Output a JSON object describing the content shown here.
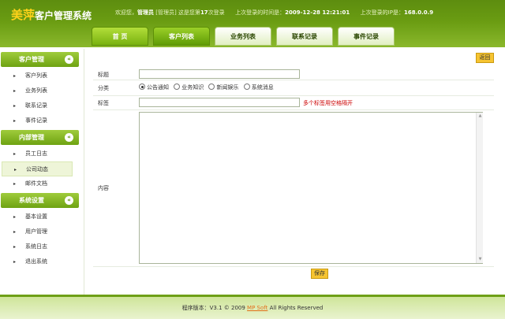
{
  "header": {
    "logo_brand": "美萍",
    "logo_rest": "客户管理系统",
    "welcome_prefix": "欢迎您，",
    "user": "管理员",
    "role": "[管理员]",
    "login_count_prefix": "这是您第",
    "login_count": "17",
    "login_count_suffix": "次登录",
    "last_time_label": "上次登录的时间是：",
    "last_time": "2009-12-28 12:21:01",
    "last_ip_label": "上次登录的IP是：",
    "last_ip": "168.0.0.9"
  },
  "tabs": [
    {
      "label": "首 页"
    },
    {
      "label": "客户列表"
    },
    {
      "label": "业务列表"
    },
    {
      "label": "联系记录"
    },
    {
      "label": "事件记录"
    }
  ],
  "sidebar": {
    "sections": [
      {
        "title": "客户管理",
        "items": [
          "客户列表",
          "业务列表",
          "联系记录",
          "事件记录"
        ]
      },
      {
        "title": "内部管理",
        "items": [
          "员工日志",
          "公司动态",
          "邮件文档"
        ]
      },
      {
        "title": "系统设置",
        "items": [
          "基本设置",
          "用户管理",
          "系统日志",
          "退出系统"
        ]
      }
    ],
    "chevron": "«"
  },
  "main": {
    "back_label": "返回",
    "title_label": "标题",
    "title_value": "",
    "category_label": "分类",
    "categories": [
      {
        "label": "公告通知",
        "checked": true
      },
      {
        "label": "业务知识",
        "checked": false
      },
      {
        "label": "新闻娱乐",
        "checked": false
      },
      {
        "label": "系统消息",
        "checked": false
      }
    ],
    "tags_label": "标签",
    "tags_value": "",
    "tags_hint": "多个标签用空格隔开",
    "content_label": "内容",
    "content_value": "",
    "save_label": "保存"
  },
  "footer": {
    "prefix": "程序版本：V3.1 © 2009 ",
    "link": "MP Soft",
    "suffix": " All Rights Reserved"
  },
  "colors": {
    "header_green": "#6a9c12",
    "accent_yellow": "#ffd21a",
    "button_yellow": "#f6c431",
    "hint_red": "#cc0000"
  }
}
